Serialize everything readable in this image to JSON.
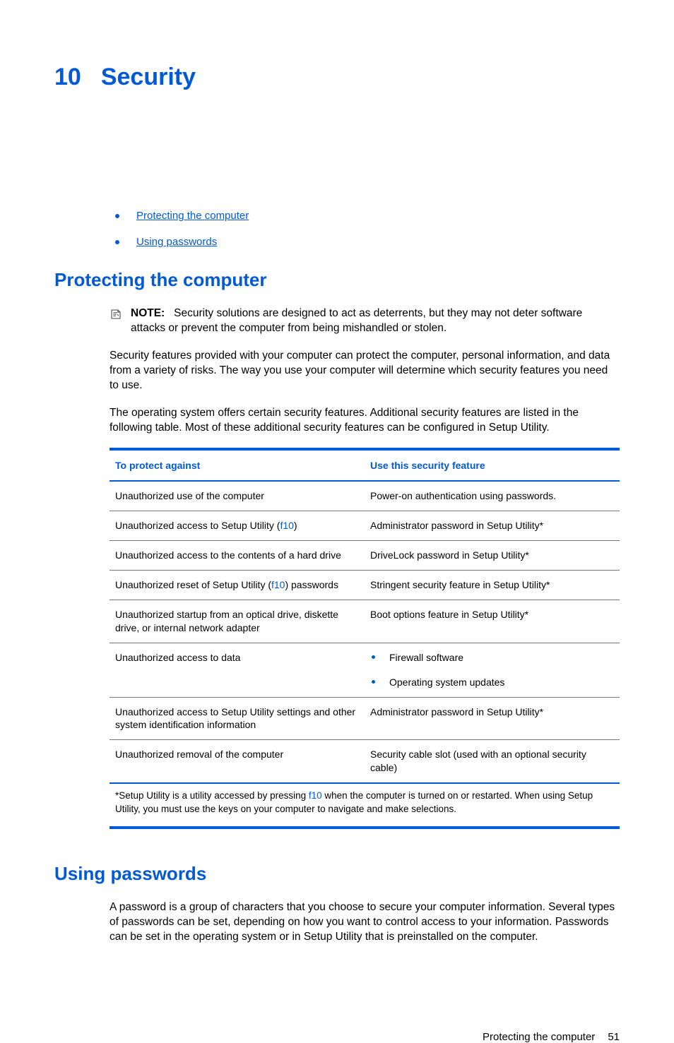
{
  "chapter": {
    "number": "10",
    "title": "Security"
  },
  "toc": [
    {
      "label": "Protecting the computer"
    },
    {
      "label": "Using passwords"
    }
  ],
  "section1": {
    "heading": "Protecting the computer",
    "note_label": "NOTE:",
    "note_text": "Security solutions are designed to act as deterrents, but they may not deter software attacks or prevent the computer from being mishandled or stolen.",
    "para1": "Security features provided with your computer can protect the computer, personal information, and data from a variety of risks. The way you use your computer will determine which security features you need to use.",
    "para2": "The operating system offers certain security features. Additional security features are listed in the following table. Most of these additional security features can be configured in Setup Utility."
  },
  "table": {
    "header": {
      "col1": "To protect against",
      "col2": "Use this security feature"
    },
    "rows": [
      {
        "c1a": "Unauthorized use of the computer",
        "c2": "Power-on authentication using passwords."
      },
      {
        "c1a": "Unauthorized access to Setup Utility (",
        "c1link": "f10",
        "c1b": ")",
        "c2": "Administrator password in Setup Utility*"
      },
      {
        "c1a": "Unauthorized access to the contents of a hard drive",
        "c2": "DriveLock password in Setup Utility*"
      },
      {
        "c1a": "Unauthorized reset of Setup Utility (",
        "c1link": "f10",
        "c1b": ") passwords",
        "c2": "Stringent security feature in Setup Utility*"
      },
      {
        "c1a": "Unauthorized startup from an optical drive, diskette drive, or internal network adapter",
        "c2": "Boot options feature in Setup Utility*"
      },
      {
        "c1a": "Unauthorized access to data",
        "c2list": [
          "Firewall software",
          "Operating system updates"
        ]
      },
      {
        "c1a": "Unauthorized access to Setup Utility settings and other system identification information",
        "c2": "Administrator password in Setup Utility*"
      },
      {
        "c1a": "Unauthorized removal of the computer",
        "c2": "Security cable slot (used with an optional security cable)"
      }
    ],
    "footnote_a": "*Setup Utility is a utility accessed by pressing ",
    "footnote_link": "f10",
    "footnote_b": " when the computer is turned on or restarted. When using Setup Utility, you must use the keys on your computer to navigate and make selections."
  },
  "section2": {
    "heading": "Using passwords",
    "para1": "A password is a group of characters that you choose to secure your computer information. Several types of passwords can be set, depending on how you want to control access to your information. Passwords can be set in the operating system or in Setup Utility that is preinstalled on the computer."
  },
  "footer": {
    "section": "Protecting the computer",
    "page": "51"
  }
}
